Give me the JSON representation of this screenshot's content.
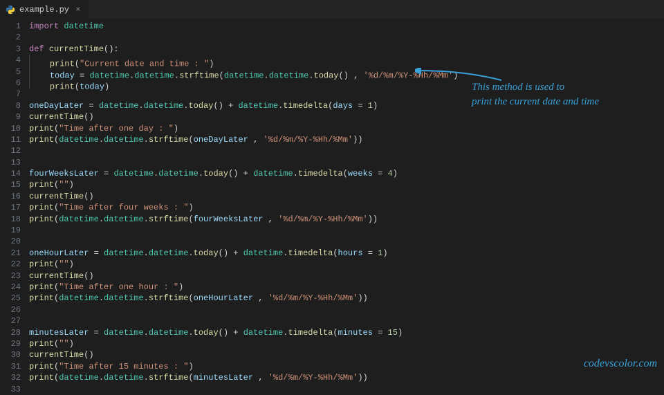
{
  "tab": {
    "filename": "example.py",
    "close_glyph": "×"
  },
  "gutter": {
    "start": 1,
    "end": 33
  },
  "code": {
    "l1_import": "import",
    "l1_mod": "datetime",
    "l3_def": "def",
    "l3_fn": "currentTime",
    "l4_print": "print",
    "l4_str": "\"Current date and time : \"",
    "l5_today": "today",
    "l5_eq": " = ",
    "l5_dt": "datetime",
    "l5_strftime": "strftime",
    "l5_todayfn": "today",
    "l5_fmt": "'%d/%m/%Y-%Hh/%Mm'",
    "l6_print": "print",
    "l6_today": "today",
    "l8_var": "oneDayLater",
    "l8_dt": "datetime",
    "l8_today": "today",
    "l8_td": "timedelta",
    "l8_arg": "days",
    "l8_num": "1",
    "l9_ct": "currentTime",
    "l10_print": "print",
    "l10_str": "\"Time after one day : \"",
    "l11_print": "print",
    "l11_dt": "datetime",
    "l11_strftime": "strftime",
    "l11_var": "oneDayLater",
    "l11_fmt": "'%d/%m/%Y-%Hh/%Mm'",
    "l14_var": "fourWeeksLater",
    "l14_dt": "datetime",
    "l14_today": "today",
    "l14_td": "timedelta",
    "l14_arg": "weeks",
    "l14_num": "4",
    "l15_print": "print",
    "l15_str": "\"\"",
    "l16_ct": "currentTime",
    "l17_print": "print",
    "l17_str": "\"Time after four weeks : \"",
    "l18_print": "print",
    "l18_dt": "datetime",
    "l18_strftime": "strftime",
    "l18_var": "fourWeeksLater",
    "l18_fmt": "'%d/%m/%Y-%Hh/%Mm'",
    "l21_var": "oneHourLater",
    "l21_dt": "datetime",
    "l21_today": "today",
    "l21_td": "timedelta",
    "l21_arg": "hours",
    "l21_num": "1",
    "l22_print": "print",
    "l22_str": "\"\"",
    "l23_ct": "currentTime",
    "l24_print": "print",
    "l24_str": "\"Time after one hour : \"",
    "l25_print": "print",
    "l25_dt": "datetime",
    "l25_strftime": "strftime",
    "l25_var": "oneHourLater",
    "l25_fmt": "'%d/%m/%Y-%Hh/%Mm'",
    "l28_var": "minutesLater",
    "l28_dt": "datetime",
    "l28_today": "today",
    "l28_td": "timedelta",
    "l28_arg": "minutes",
    "l28_num": "15",
    "l29_print": "print",
    "l29_str": "\"\"",
    "l30_ct": "currentTime",
    "l31_print": "print",
    "l31_str": "\"Time after 15 minutes : \"",
    "l32_print": "print",
    "l32_dt": "datetime",
    "l32_strftime": "strftime",
    "l32_var": "minutesLater",
    "l32_fmt": "'%d/%m/%Y-%Hh/%Mm'"
  },
  "annotation": {
    "line1": "This method is used to",
    "line2": "print the current date and time"
  },
  "watermark": "codevscolor.com",
  "colors": {
    "accent": "#3aa0d8",
    "bg": "#1e1e1e"
  }
}
